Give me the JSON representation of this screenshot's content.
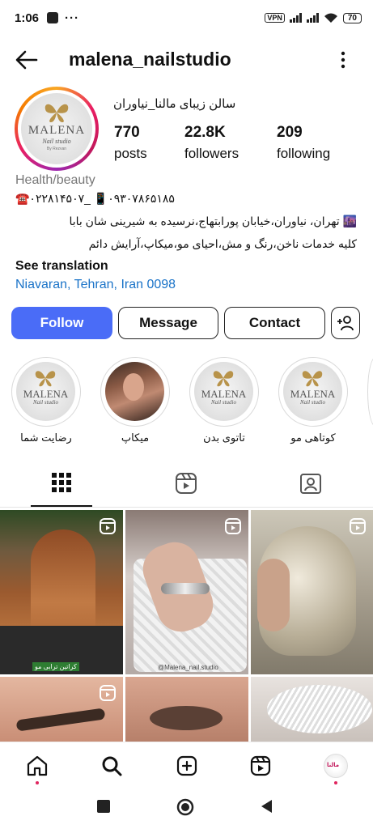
{
  "status_bar": {
    "time": "1:06",
    "dots": "···",
    "vpn": "VPN",
    "battery": "70"
  },
  "header": {
    "username": "malena_nailstudio"
  },
  "profile": {
    "logo_brand": "MALENA",
    "logo_sub": "Nail studio",
    "logo_by": "By Rezvan",
    "full_name": "سالن زیبای مالنا_نیاوران",
    "stats": [
      {
        "value": "770",
        "label": "posts"
      },
      {
        "value": "22.8K",
        "label": "followers"
      },
      {
        "value": "209",
        "label": "following"
      }
    ],
    "category": "Health/beauty",
    "bio_lines": [
      "☎️۰۲۲۸۱۴۵۰۷_ 📱۰۹۳۰۷۸۶۵۱۸۵",
      "🌆 تهران، نیاوران،خیابان پورابتهاج،نرسیده به شیرینی شان بابا",
      "کلیه خدمات ناخن،رنگ و مش،احیای مو،میکاپ،آرایش دائم"
    ],
    "see_translation": "See translation",
    "location": "Niavaran, Tehran, Iran 0098"
  },
  "actions": {
    "follow": "Follow",
    "message": "Message",
    "contact": "Contact"
  },
  "highlights": [
    {
      "label": "رضایت شما",
      "type": "logo"
    },
    {
      "label": "میکاپ",
      "type": "photo"
    },
    {
      "label": "تاتوی بدن",
      "type": "logo"
    },
    {
      "label": "کوتاهی مو",
      "type": "logo"
    }
  ],
  "grid": {
    "post1_tag": "کراتین ترابی مو",
    "post2_watermark": "@Malena_nail.studio"
  },
  "bottom_nav": {
    "avatar_text": "مالنا"
  },
  "colors": {
    "follow_button": "#4a6cf7",
    "link": "#1a73c8",
    "notification_dot": "#e0245e"
  }
}
